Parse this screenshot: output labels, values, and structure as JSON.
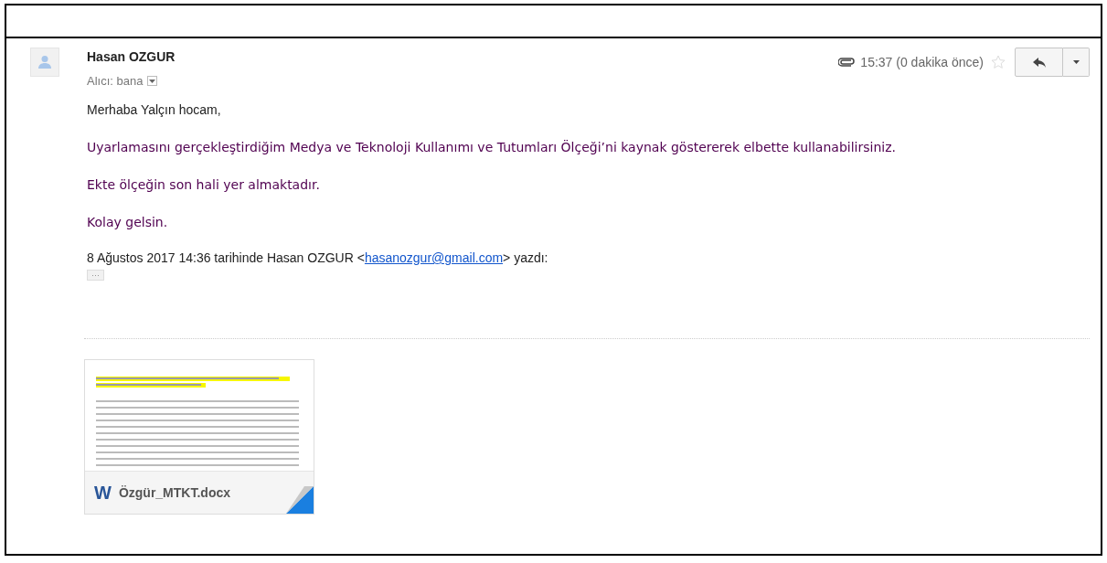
{
  "message": {
    "sender": "Hasan OZGUR",
    "recipient": "Alıcı: bana",
    "has_attachment": true,
    "time": "15:37 (0 dakika önce)",
    "starred": false
  },
  "body": [
    "Merhaba Yalçın hocam,",
    "Uyarlamasını gerçekleştirdiğim Medya ve Teknoloji Kullanımı ve Tutumları Ölçeği’ni kaynak göstererek elbette kullanabilirsiniz.",
    "Ekte ölçeğin son hali yer almaktadır.",
    "Kolay gelsin."
  ],
  "quote": {
    "before": "8 Ağustos 2017 14:36 tarihinde Hasan OZGUR <",
    "link": "hasanozgur@gmail.com",
    "after": "> yazdı:",
    "toggle": "···"
  },
  "attachments": [
    {
      "name": "Özgür_MTKT.docx",
      "kind": "word",
      "icon": "W"
    }
  ]
}
